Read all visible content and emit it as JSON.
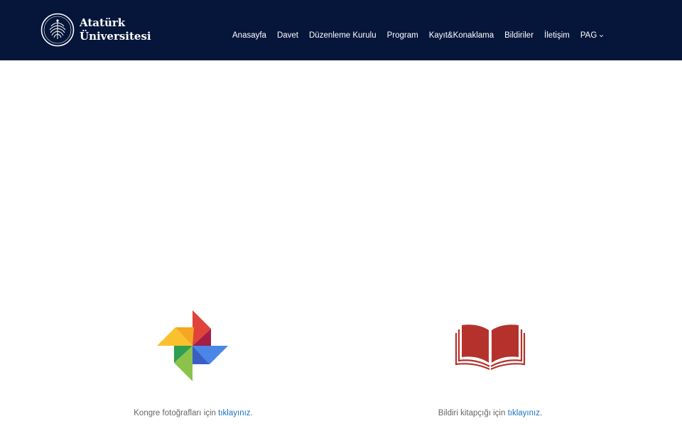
{
  "header": {
    "logo": {
      "line1": "Atatürk",
      "line2": "Üniversitesi"
    },
    "nav": [
      {
        "label": "Anasayfa"
      },
      {
        "label": "Davet"
      },
      {
        "label": "Düzenleme Kurulu"
      },
      {
        "label": "Program"
      },
      {
        "label": "Kayıt&Konaklama"
      },
      {
        "label": "Bildiriler"
      },
      {
        "label": "İletişim"
      },
      {
        "label": "PAG",
        "has_dropdown": true,
        "icon": "chevron-down-icon"
      }
    ]
  },
  "content": {
    "photos": {
      "icon": "pinwheel-photos-icon",
      "text": "Kongre fotoğrafları için ",
      "link": "tıklayınız",
      "suffix": "."
    },
    "book": {
      "icon": "open-book-icon",
      "text": "Bildiri kitapçığı için ",
      "link": "tıklayınız",
      "suffix": "."
    }
  },
  "colors": {
    "header_bg": "#06163a",
    "link": "#1a73c8",
    "caption": "#666666",
    "book": "#b5322c"
  }
}
